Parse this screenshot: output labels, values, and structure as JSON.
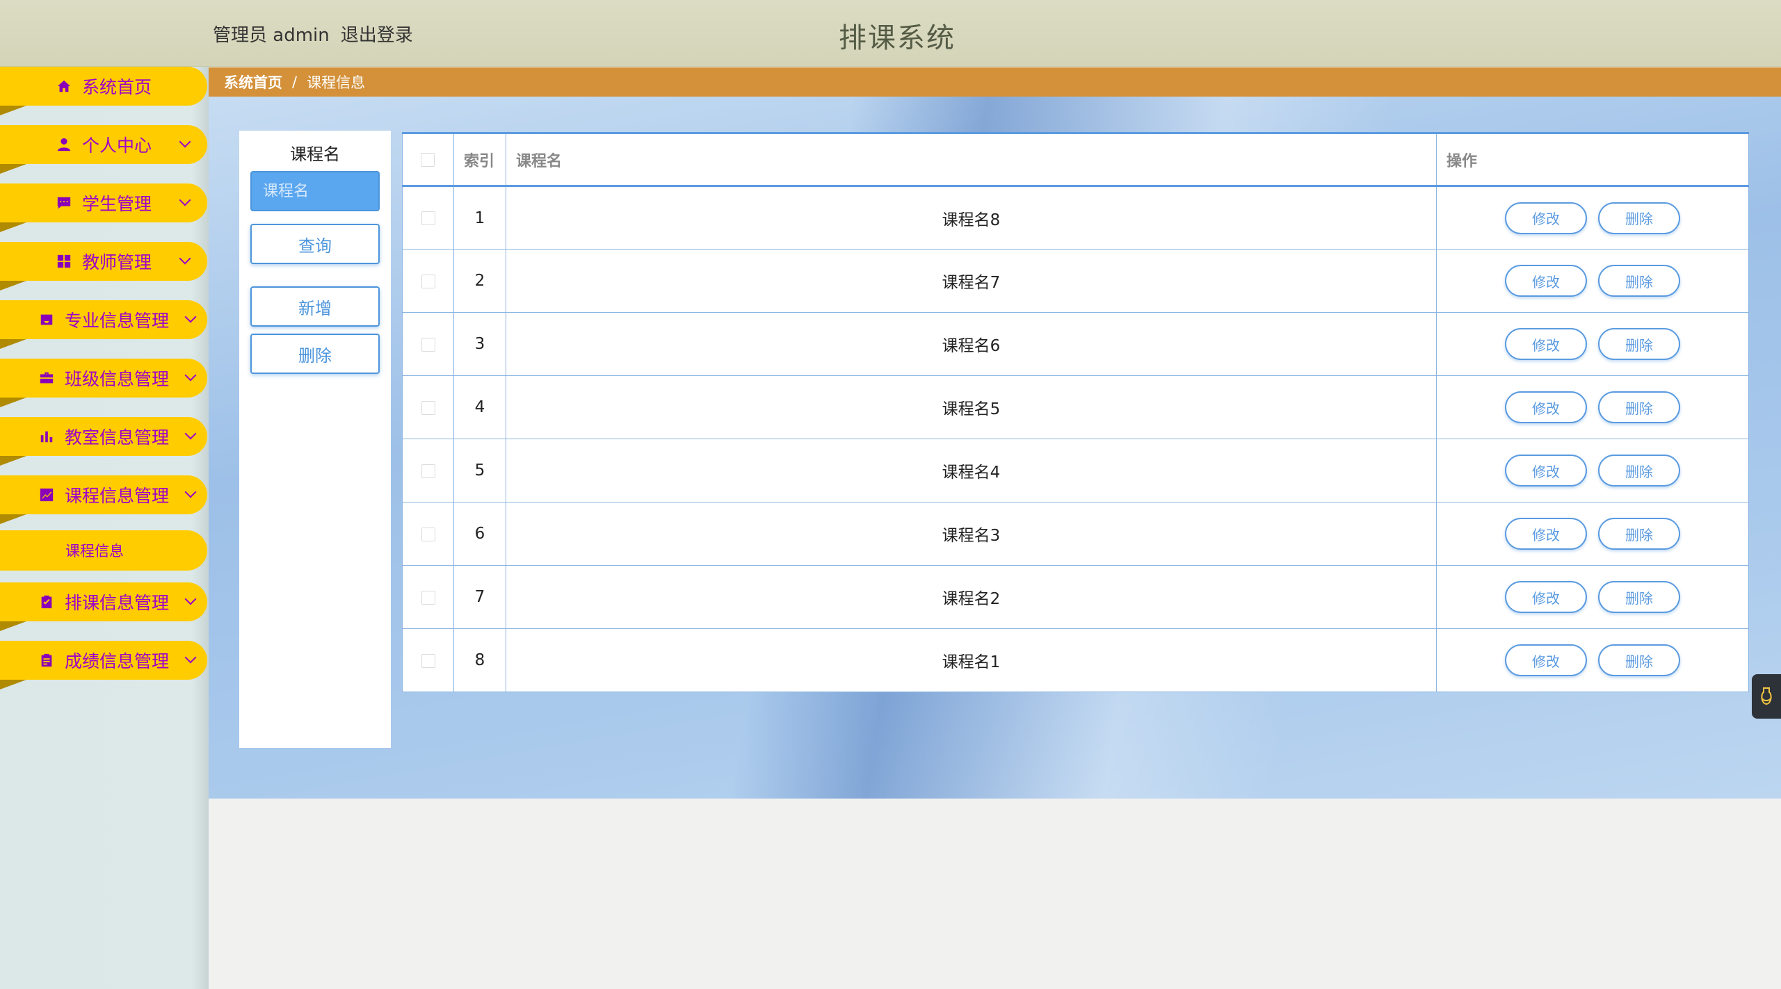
{
  "header": {
    "role": "管理员",
    "username": "admin",
    "logout_label": "退出登录",
    "system_title": "排课系统"
  },
  "sidebar": {
    "items": [
      {
        "label": "系统首页",
        "icon": "home-icon"
      },
      {
        "label": "个人中心",
        "icon": "user-icon"
      },
      {
        "label": "学生管理",
        "icon": "chat-icon"
      },
      {
        "label": "教师管理",
        "icon": "grid-icon"
      },
      {
        "label": "专业信息管理",
        "icon": "inbox-icon"
      },
      {
        "label": "班级信息管理",
        "icon": "briefcase-icon"
      },
      {
        "label": "教室信息管理",
        "icon": "bar-chart-icon"
      },
      {
        "label": "课程信息管理",
        "icon": "line-chart-icon"
      },
      {
        "label": "排课信息管理",
        "icon": "clipboard-check-icon"
      },
      {
        "label": "成绩信息管理",
        "icon": "clipboard-list-icon"
      }
    ],
    "active_submenu": "课程信息"
  },
  "breadcrumb": {
    "home": "系统首页",
    "separator": "/",
    "current": "课程信息"
  },
  "search": {
    "label": "课程名",
    "placeholder": "课程名",
    "query_button": "查询",
    "add_button": "新增",
    "delete_button": "删除"
  },
  "table": {
    "headers": {
      "index": "索引",
      "name": "课程名",
      "actions": "操作"
    },
    "edit_label": "修改",
    "delete_label": "删除",
    "rows": [
      {
        "index": "1",
        "name": "课程名8"
      },
      {
        "index": "2",
        "name": "课程名7"
      },
      {
        "index": "3",
        "name": "课程名6"
      },
      {
        "index": "4",
        "name": "课程名5"
      },
      {
        "index": "5",
        "name": "课程名4"
      },
      {
        "index": "6",
        "name": "课程名3"
      },
      {
        "index": "7",
        "name": "课程名2"
      },
      {
        "index": "8",
        "name": "课程名1"
      }
    ]
  },
  "colors": {
    "sidebar_pill": "#ffcc00",
    "sidebar_text": "#a000c8",
    "breadcrumb_bg": "#d4913a",
    "accent_blue": "#5b9be0"
  }
}
